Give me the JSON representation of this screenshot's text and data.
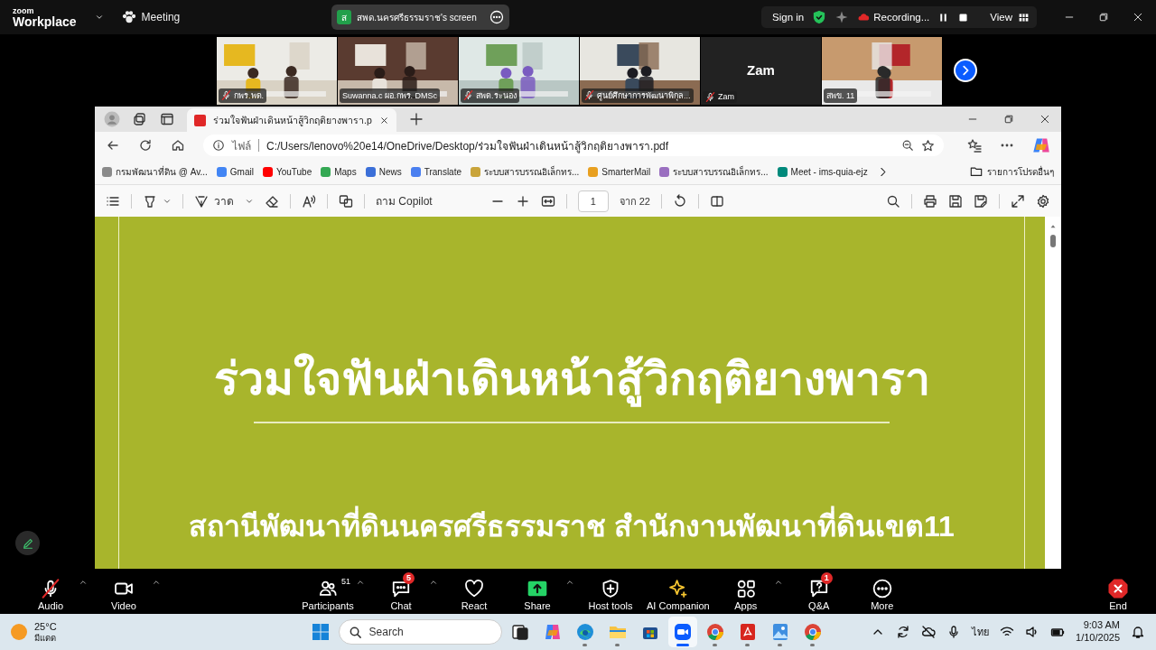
{
  "top_bar": {
    "logo_small": "zoom",
    "logo": "Workplace",
    "meeting": "Meeting",
    "share_banner": {
      "badge": "ส",
      "text": "สพด.นครศรีธรรมราช's screen"
    },
    "sign_in": "Sign in",
    "recording": "Recording...",
    "view": "View"
  },
  "thumbnails": [
    {
      "kind": "video",
      "label": "กพร.พด.",
      "muted": true
    },
    {
      "kind": "video",
      "label": "Suwanna.c ผอ.กพร. DMSc",
      "muted": false
    },
    {
      "kind": "video",
      "label": "สพด.ระนอง",
      "muted": true
    },
    {
      "kind": "video",
      "label": "ศูนย์ศึกษาการพัฒนาพิกุล...",
      "muted": true
    },
    {
      "kind": "name_only",
      "display_name": "Zam",
      "label": "Zam",
      "muted": true
    },
    {
      "kind": "video",
      "label": "สพข. 11",
      "muted": false
    }
  ],
  "browser": {
    "tab_title": "ร่วมใจฟันฝ่าเดินหน้าสู้วิกฤติยางพารา.p",
    "address_prefix": "ไฟล์",
    "url": "C:/Users/lenovo%20e14/OneDrive/Desktop/ร่วมใจฟันฝ่าเดินหน้าสู้วิกฤติยางพารา.pdf",
    "bookmarks": [
      {
        "label": "กรมพัฒนาที่ดิน @ Av...",
        "color": "#8a8a8a"
      },
      {
        "label": "Gmail",
        "color": "#4285f4"
      },
      {
        "label": "YouTube",
        "color": "#ff0000"
      },
      {
        "label": "Maps",
        "color": "#34a853"
      },
      {
        "label": "News",
        "color": "#3b6fd8"
      },
      {
        "label": "Translate",
        "color": "#4a7ff0"
      },
      {
        "label": "ระบบสารบรรณอิเล็กทร...",
        "color": "#c9a43a"
      },
      {
        "label": "SmarterMail",
        "color": "#e8a020"
      },
      {
        "label": "ระบบสารบรรณอิเล็กทร...",
        "color": "#9a6fc0"
      },
      {
        "label": "Meet - ims-quia-ejz",
        "color": "#00897b"
      }
    ],
    "other_favorites": "รายการโปรดอื่นๆ",
    "pdf_toolbar": {
      "draw": "วาด",
      "copilot": "ถาม Copilot",
      "page": "1",
      "page_total": "จาก 22"
    }
  },
  "slide": {
    "title": "ร่วมใจฟันฝ่าเดินหน้าสู้วิกฤติยางพารา",
    "subtitle": "สถานีพัฒนาที่ดินนครศรีธรรมราช สำนักงานพัฒนาที่ดินเขต11"
  },
  "meeting_toolbar": [
    {
      "kind": "audio",
      "label": "Audio",
      "muted": true,
      "menu": true
    },
    {
      "kind": "video",
      "label": "Video",
      "menu": true
    },
    {
      "kind": "participants",
      "label": "Participants",
      "count": "51",
      "menu": true
    },
    {
      "kind": "chat",
      "label": "Chat",
      "badge": "5",
      "menu": true
    },
    {
      "kind": "react",
      "label": "React",
      "menu": false
    },
    {
      "kind": "share",
      "label": "Share",
      "menu": true
    },
    {
      "kind": "host",
      "label": "Host tools",
      "menu": false
    },
    {
      "kind": "ai",
      "label": "AI Companion",
      "menu": false
    },
    {
      "kind": "apps",
      "label": "Apps",
      "menu": true
    },
    {
      "kind": "qa",
      "label": "Q&A",
      "badge": "1",
      "menu": false
    },
    {
      "kind": "more",
      "label": "More",
      "menu": false
    },
    {
      "kind": "end",
      "label": "End",
      "menu": false
    }
  ],
  "taskbar": {
    "temperature": "25°C",
    "condition": "มีแดด",
    "search_placeholder": "Search",
    "apps": [
      {
        "kind": "taskview",
        "selected": false,
        "running": false
      },
      {
        "kind": "copilot",
        "selected": false,
        "running": false
      },
      {
        "kind": "edge",
        "selected": false,
        "running": true
      },
      {
        "kind": "explorer",
        "selected": false,
        "running": true
      },
      {
        "kind": "store",
        "selected": false,
        "running": false
      },
      {
        "kind": "zoom",
        "selected": true,
        "running": true
      },
      {
        "kind": "chrome",
        "selected": false,
        "running": true
      },
      {
        "kind": "acrobat",
        "selected": false,
        "running": true
      },
      {
        "kind": "photos",
        "selected": false,
        "running": true
      },
      {
        "kind": "chrome",
        "selected": false,
        "running": true
      }
    ],
    "language": "ไทย",
    "time": "9:03 AM",
    "date": "1/10/2025"
  }
}
